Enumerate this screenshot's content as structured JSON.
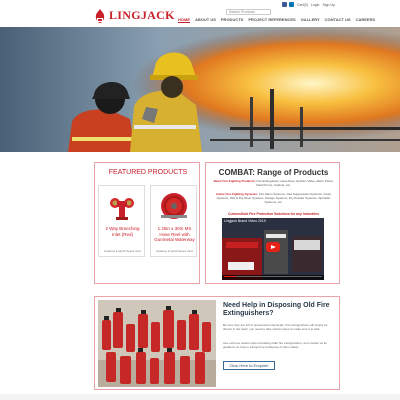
{
  "header": {
    "brand": "LINGJACK",
    "search_placeholder": "Search Products",
    "account_links": [
      "Cart(0)",
      "Login",
      "Sign Up"
    ],
    "nav": [
      "HOME",
      "ABOUT US",
      "PRODUCTS",
      "PROJECT REFERENCES",
      "GALLERY",
      "CONTACT US",
      "CAREERS"
    ],
    "active_nav": "HOME",
    "brand_color": "#c8202a"
  },
  "hero": {
    "alt_icon": "firefighters-hero-image"
  },
  "featured": {
    "title": "FEATURED PRODUCTS",
    "products": [
      {
        "name": "2 Way Breeching Inlet (Red)",
        "link": "Features & Quick Specs View"
      },
      {
        "name": "1.25in x 30m MS Hose Reel with Gunmetal Waterway",
        "link": "Features & Quick Specs View"
      }
    ]
  },
  "combat": {
    "title": "COMBAT: Range of Products",
    "line1_label": "Basic Fire-Fighting Products:",
    "line1_text": "Fire Extinguisher, Hose Reel, Hydrant Valve, Alarm Panel, Flash Pump, Cabinet, etc.",
    "line2_label": "Active Fire-Fighting Systems:",
    "line2_text": "Fire Alarm Systems, Gas Suppression Systems, Foam Systems, Wet & Dry Riser Systems, Deluge Systems, Dry Powder Systems, Sprinkler Systems, etc.",
    "cta": "CustomGold Fire Protection Solutions for any Industries",
    "video_title": "Lingjack Brand Video 2019"
  },
  "disposal": {
    "title": "Need Help in Disposing Old Fire Extinguishers?",
    "para1": "Be sure they are full of pressurized chemicals. Fire extinguishers will simply be thrown in the trash, you need to take certain steps to make sure it is safe.",
    "para2": "Use extreme caution when handling older fire extinguishers, and contact us for guidance on how to transport and dispose of them safely.",
    "button": "Click Here to Enquire!"
  }
}
